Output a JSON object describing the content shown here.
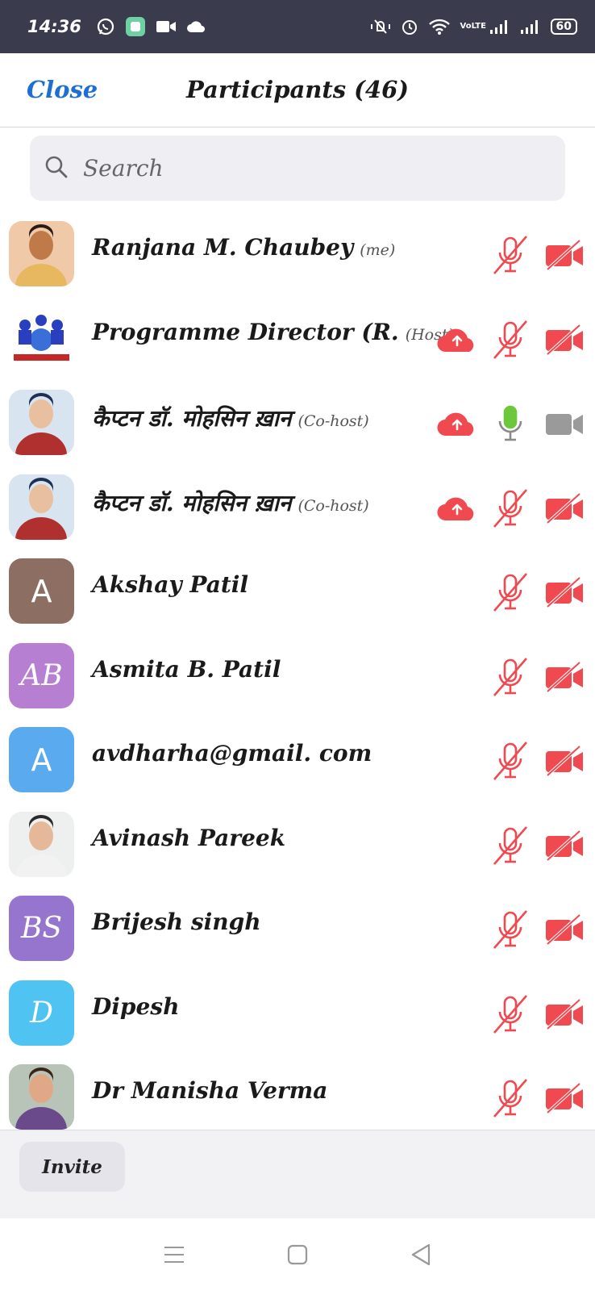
{
  "status_bar": {
    "time": "14:36",
    "battery": "60",
    "volte": "VoLTE"
  },
  "header": {
    "close_label": "Close",
    "title": "Participants (46)"
  },
  "search": {
    "placeholder": "Search"
  },
  "participants": [
    {
      "name": "Ranjana M.  Chaubey",
      "role": "(me)",
      "avatar_type": "photo",
      "cloud": false,
      "mic": "muted",
      "video": "off"
    },
    {
      "name": "Programme Director (R.",
      "role": "(Host)",
      "avatar_type": "logo",
      "cloud": true,
      "mic": "muted",
      "video": "off"
    },
    {
      "name": "कैप्टन डॉ. मोहसिन ख़ान",
      "role": "(Co-host)",
      "avatar_type": "photo",
      "cloud": true,
      "mic": "active",
      "video": "inactive"
    },
    {
      "name": "कैप्टन डॉ. मोहसिन ख़ान",
      "role": "(Co-host)",
      "avatar_type": "photo",
      "cloud": true,
      "mic": "muted",
      "video": "off"
    },
    {
      "name": "Akshay Patil",
      "role": "",
      "avatar_type": "initials",
      "initials": "A",
      "avatar_color": "#8c6e62",
      "cloud": false,
      "mic": "muted",
      "video": "off"
    },
    {
      "name": "Asmita B. Patil",
      "role": "",
      "avatar_type": "initials",
      "initials": "AB",
      "avatar_color": "#b77fd1",
      "cloud": false,
      "mic": "muted",
      "video": "off"
    },
    {
      "name": "avdharha@gmail. com",
      "role": "",
      "avatar_type": "initials",
      "initials": "A",
      "avatar_color": "#5aaaf0",
      "cloud": false,
      "mic": "muted",
      "video": "off"
    },
    {
      "name": "Avinash Pareek",
      "role": "",
      "avatar_type": "photo",
      "cloud": false,
      "mic": "muted",
      "video": "off"
    },
    {
      "name": "Brijesh singh",
      "role": "",
      "avatar_type": "initials",
      "initials": "BS",
      "avatar_color": "#9575cd",
      "cloud": false,
      "mic": "muted",
      "video": "off"
    },
    {
      "name": "Dipesh",
      "role": "",
      "avatar_type": "initials",
      "initials": "D",
      "avatar_color": "#4fc3f2",
      "cloud": false,
      "mic": "muted",
      "video": "off"
    },
    {
      "name": "Dr Manisha Verma",
      "role": "",
      "avatar_type": "photo",
      "cloud": false,
      "mic": "muted",
      "video": "off"
    }
  ],
  "footer": {
    "invite_label": "Invite"
  },
  "colors": {
    "accent": "#1d6fd1",
    "muted_red": "#f0494f",
    "active_green": "#6bc83a",
    "inactive_gray": "#9a9a9a"
  }
}
